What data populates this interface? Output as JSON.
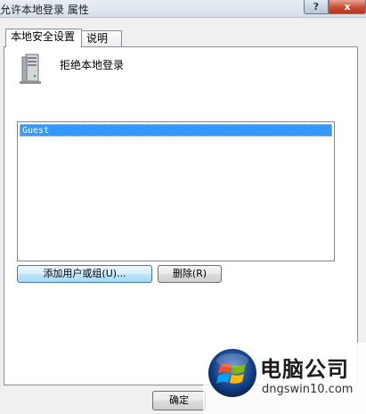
{
  "window": {
    "title": "允许本地登录 属性",
    "help_label": "?",
    "close_label": "x"
  },
  "tabs": [
    {
      "label": "本地安全设置",
      "active": true
    },
    {
      "label": "说明",
      "active": false
    }
  ],
  "policy": {
    "icon": "server-icon",
    "name": "拒绝本地登录"
  },
  "members_list": {
    "items": [
      "Guest"
    ],
    "selected": "Guest"
  },
  "buttons": {
    "add": "添加用户或组(U)...",
    "remove": "删除(R)",
    "ok": "确定"
  },
  "watermark": {
    "brand": "电脑公司",
    "url": "dngswin10.com",
    "logo": "windows-logo-icon"
  },
  "colors": {
    "selection": "#3399ff",
    "close_button": "#c94d32"
  }
}
